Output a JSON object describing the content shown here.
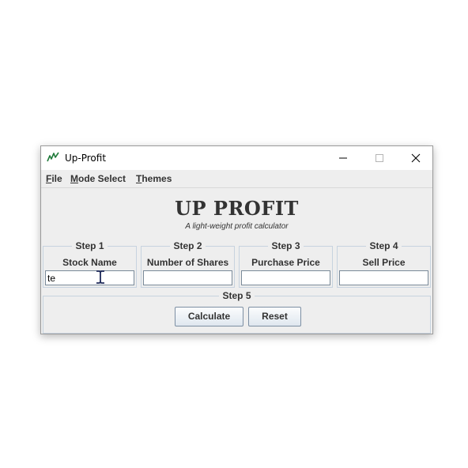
{
  "window": {
    "title": "Up-Profit",
    "icon": "chart-trend-icon"
  },
  "titlebar_buttons": [
    "minimize-icon",
    "maximize-icon",
    "close-icon"
  ],
  "menu": [
    {
      "mnemonic": "F",
      "rest": "ile"
    },
    {
      "mnemonic": "M",
      "rest": "ode Select"
    },
    {
      "mnemonic": "T",
      "rest": "hemes"
    }
  ],
  "header": {
    "title": "UP PROFIT",
    "subtitle": "A light-weight profit calculator"
  },
  "steps": [
    {
      "legend": "Step 1",
      "label": "Stock Name",
      "value": "te"
    },
    {
      "legend": "Step 2",
      "label": "Number of Shares",
      "value": ""
    },
    {
      "legend": "Step 3",
      "label": "Purchase Price",
      "value": ""
    },
    {
      "legend": "Step 4",
      "label": "Sell Price",
      "value": ""
    }
  ],
  "step5": {
    "legend": "Step 5",
    "calculate_label": "Calculate",
    "reset_label": "Reset"
  },
  "colors": {
    "accent": "#1f7a3a",
    "window_bg": "#eeeeee",
    "border": "#c7d3df"
  }
}
